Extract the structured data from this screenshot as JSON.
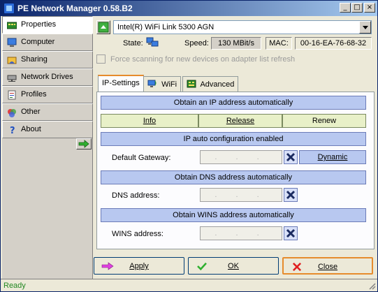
{
  "window": {
    "title": "PE Network Manager 0.58.B2"
  },
  "title_buttons": {
    "minimize": "_",
    "maximize": "□",
    "close": "×"
  },
  "sidebar": {
    "items": [
      {
        "label": "Properties",
        "icon": "properties-icon",
        "active": true
      },
      {
        "label": "Computer",
        "icon": "computer-icon",
        "active": false
      },
      {
        "label": "Sharing",
        "icon": "sharing-icon",
        "active": false
      },
      {
        "label": "Network Drives",
        "icon": "network-drives-icon",
        "active": false
      },
      {
        "label": "Profiles",
        "icon": "profiles-icon",
        "active": false
      },
      {
        "label": "Other",
        "icon": "other-icon",
        "active": false
      },
      {
        "label": "About",
        "icon": "about-icon",
        "active": false
      }
    ]
  },
  "adapter": {
    "selected": "Intel(R) WiFi Link 5300 AGN",
    "state_label": "State:",
    "speed_label": "Speed:",
    "speed_value": "130 MBit/s",
    "mac_label": "MAC:",
    "mac_value": "00-16-EA-76-68-32",
    "force_scan_label": "Force scanning for new devices on adapter list refresh"
  },
  "tabs": [
    {
      "label": "IP-Settings",
      "active": true
    },
    {
      "label": "WiFi",
      "active": false
    },
    {
      "label": "Advanced",
      "active": false
    }
  ],
  "ip_settings": {
    "obtain_ip": "Obtain an IP address automatically",
    "info": "Info",
    "release": "Release",
    "renew": "Renew",
    "ip_auto_config": "IP auto configuration enabled",
    "default_gateway_label": "Default Gateway:",
    "dynamic": "Dynamic",
    "obtain_dns": "Obtain DNS address automatically",
    "dns_label": "DNS address:",
    "obtain_wins": "Obtain WINS address automatically",
    "wins_label": "WINS address:",
    "ip_placeholder": ". . ."
  },
  "actions": {
    "apply": "Apply",
    "ok": "OK",
    "close": "Close"
  },
  "status": {
    "text": "Ready"
  },
  "colors": {
    "accent_bar": "#b8c8f0",
    "button_green": "#e8f0c8",
    "status_green": "#228822"
  }
}
